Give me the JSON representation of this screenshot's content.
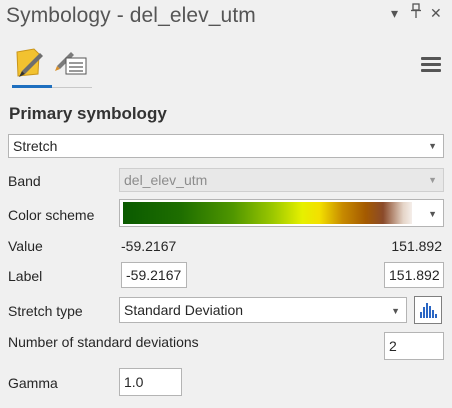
{
  "header": {
    "title": "Symbology - del_elev_utm",
    "dropdown_icon": "▾",
    "pin_icon": "ᵖ",
    "close_icon": "✕"
  },
  "tabs": [
    {
      "icon": "primary-symbology-icon",
      "active": true
    },
    {
      "icon": "symbology-properties-icon",
      "active": false
    }
  ],
  "menu_icon": "hamburger-menu-icon",
  "section": {
    "title": "Primary symbology"
  },
  "renderer": {
    "value": "Stretch"
  },
  "band": {
    "label": "Band",
    "value": "del_elev_utm"
  },
  "color_scheme": {
    "label": "Color scheme"
  },
  "value_row": {
    "label": "Value",
    "min": "-59.2167",
    "max": "151.892"
  },
  "label_row": {
    "label": "Label",
    "min": "-59.2167",
    "max": "151.892"
  },
  "stretch_type": {
    "label": "Stretch type",
    "value": "Standard Deviation"
  },
  "std_dev": {
    "label": "Number of standard deviations",
    "value": "2"
  },
  "gamma": {
    "label": "Gamma",
    "value": "1.0"
  },
  "colors": {
    "accent": "#1e6fbf",
    "background": "#f0f0f0"
  }
}
